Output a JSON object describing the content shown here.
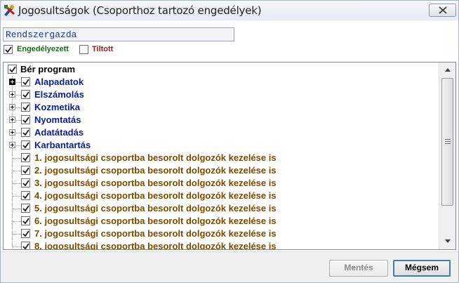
{
  "window": {
    "title": "Jogosultságok (Csoporthoz tartozó engedélyek)"
  },
  "group_field": {
    "value": "Rendszergazda"
  },
  "filters": [
    {
      "label": "Engedélyezett",
      "checked": true,
      "color": "#1a6b1a"
    },
    {
      "label": "Tiltott",
      "checked": false,
      "color": "#9b1a1a"
    }
  ],
  "tree": {
    "root": {
      "label": "Bér program",
      "checked": true
    },
    "folders": [
      {
        "label": "Alapadatok",
        "checked": true,
        "focused": true
      },
      {
        "label": "Elszámolás",
        "checked": true
      },
      {
        "label": "Kozmetika",
        "checked": true
      },
      {
        "label": "Nyomtatás",
        "checked": true
      },
      {
        "label": "Adatátadás",
        "checked": true
      },
      {
        "label": "Karbantartás",
        "checked": true
      }
    ],
    "permissions": [
      {
        "label": "1. jogosultsági csoportba besorolt dolgozók kezelése is",
        "checked": true
      },
      {
        "label": "2. jogosultsági csoportba besorolt dolgozók kezelése is",
        "checked": true
      },
      {
        "label": "3. jogosultsági csoportba besorolt dolgozók kezelése is",
        "checked": true
      },
      {
        "label": "4. jogosultsági csoportba besorolt dolgozók kezelése is",
        "checked": true
      },
      {
        "label": "5. jogosultsági csoportba besorolt dolgozók kezelése is",
        "checked": true
      },
      {
        "label": "6. jogosultsági csoportba besorolt dolgozók kezelése is",
        "checked": true
      },
      {
        "label": "7. jogosultsági csoportba besorolt dolgozók kezelése is",
        "checked": true
      },
      {
        "label": "8. jogosultsági csoportba besorolt dolgozók kezelése is",
        "checked": true
      }
    ]
  },
  "colors": {
    "root_text": "#000000",
    "folder_text": "#0a1e8c",
    "permission_text": "#7a4a00"
  },
  "buttons": {
    "save": {
      "label": "Mentés",
      "enabled": false
    },
    "cancel": {
      "label": "Mégsem",
      "enabled": true
    }
  }
}
